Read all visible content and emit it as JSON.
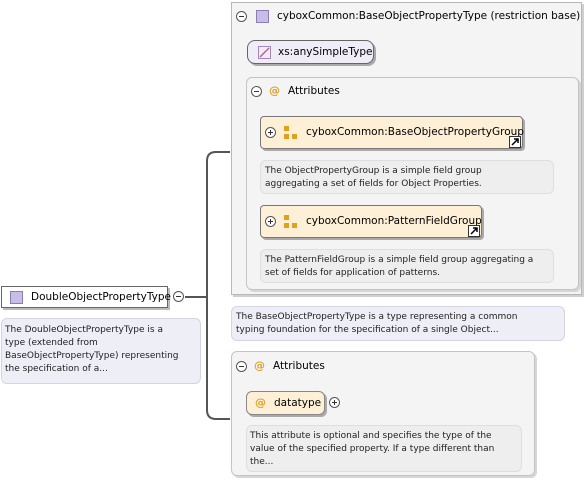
{
  "root": {
    "name": "DoubleObjectPropertyType",
    "doc": [
      "The DoubleObjectPropertyType is a",
      "type (extended from",
      "BaseObjectPropertyType) representing",
      "the specification of a..."
    ]
  },
  "base": {
    "title": "cyboxCommon:BaseObjectPropertyType (restriction base)",
    "simple_type": "xs:anySimpleType",
    "doc": [
      "The BaseObjectPropertyType is a type representing a common",
      "typing foundation for the specification of a single Object..."
    ],
    "attributes_label": "Attributes",
    "groups": [
      {
        "name": "cyboxCommon:BaseObjectPropertyGroup",
        "doc": [
          "The ObjectPropertyGroup is a simple field group",
          "aggregating a set of fields for Object Properties."
        ]
      },
      {
        "name": "cyboxCommon:PatternFieldGroup",
        "doc": [
          "The PatternFieldGroup is a simple field group aggregating a",
          "set of fields for application of patterns."
        ]
      }
    ]
  },
  "ext": {
    "attributes_label": "Attributes",
    "attribute": {
      "name": "datatype",
      "doc": [
        "This attribute is optional and specifies the type of the",
        "value of the specified property. If a type different than",
        "the..."
      ]
    }
  },
  "colors": {
    "connector": "#555555",
    "group_fill": "#fdf0d6",
    "box_border": "#b8b8b8"
  }
}
